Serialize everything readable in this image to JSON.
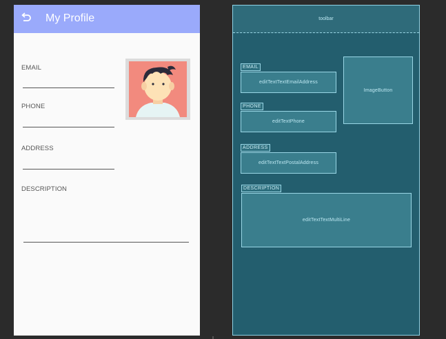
{
  "design": {
    "toolbar": {
      "title": "My Profile",
      "back_icon": "back-arrow-icon"
    },
    "fields": {
      "email_label": "EMAIL",
      "phone_label": "PHONE",
      "address_label": "ADDRESS",
      "description_label": "DESCRIPTION"
    },
    "avatar": {
      "icon": "profile-avatar-icon"
    },
    "colors": {
      "appbar": "#9aaafb",
      "background": "#fafafa"
    }
  },
  "blueprint": {
    "toolbar": "toolbar",
    "email_label": "EMAIL",
    "email_field": "editTextTextEmailAddress",
    "phone_label": "PHONE",
    "phone_field": "editTextPhone",
    "address_label": "ADDRESS",
    "address_field": "editTextTextPostalAddress",
    "description_label": "DESCRIPTION",
    "description_field": "editTextTextMultiLine",
    "image_button": "ImageButton",
    "colors": {
      "background": "#235e6e",
      "outline": "#9ad7e6"
    }
  }
}
